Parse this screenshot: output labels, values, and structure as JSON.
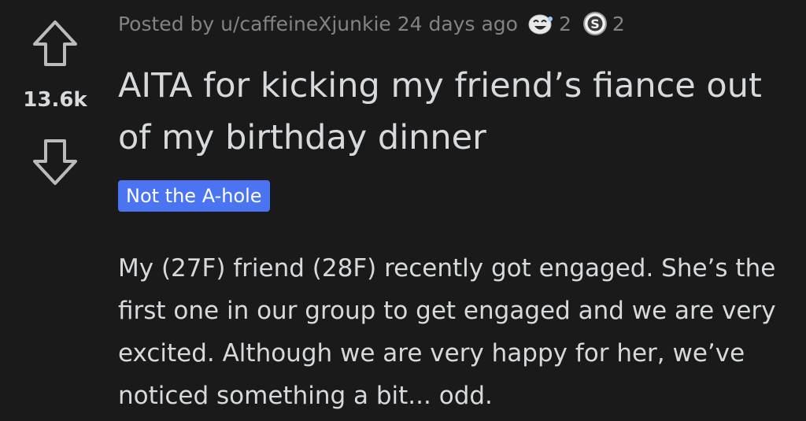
{
  "post": {
    "meta": {
      "posted_by": "Posted by u/caffeineXjunkie 24 days ago",
      "awards": [
        {
          "icon": "laughing-face-award-icon",
          "count": "2"
        },
        {
          "icon": "silver-s-award-icon",
          "count": "2"
        }
      ]
    },
    "score": "13.6k",
    "title": "AITA for kicking my friend’s fiance out of my birthday dinner",
    "flair": "Not the A-hole",
    "body": "My (27F) friend (28F) recently got engaged. She’s the first one in our group to get engaged and we are very excited. Although we are very happy for her, we’ve noticed something a bit... odd."
  },
  "colors": {
    "background": "#1a1a1b",
    "text": "#d7dadc",
    "meta_text": "#818384",
    "flair_bg": "#4b74f2",
    "flair_text": "#ffffff"
  },
  "icons": {
    "upvote": "upvote-arrow-icon",
    "downvote": "downvote-arrow-icon"
  }
}
